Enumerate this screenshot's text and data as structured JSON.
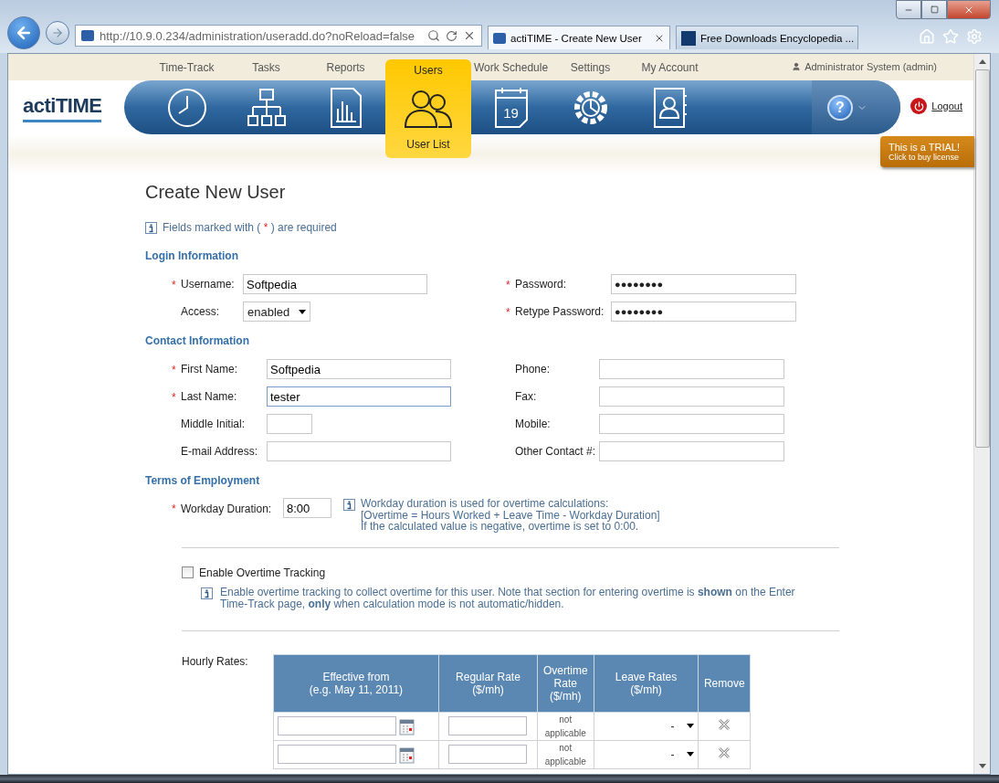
{
  "browser": {
    "url": "http://10.9.0.234/administration/useradd.do?noReload=false",
    "tabs": [
      {
        "title": "actiTIME - Create New User",
        "selected": true
      },
      {
        "title": "Free Downloads Encyclopedia ...",
        "selected": false
      }
    ]
  },
  "nav": {
    "tabs": [
      {
        "label": "Time-Track",
        "selected": false
      },
      {
        "label": "Tasks",
        "selected": false
      },
      {
        "label": "Reports",
        "selected": false
      },
      {
        "label": "Users",
        "selected": true,
        "sublabel": "User List"
      },
      {
        "label": "Work Schedule",
        "selected": false,
        "icon_text": "19"
      },
      {
        "label": "Settings",
        "selected": false
      },
      {
        "label": "My Account",
        "selected": false
      }
    ],
    "logo": "actiTIME",
    "help": "?",
    "user": "Administrator System (admin)",
    "logout": "Logout",
    "trial": {
      "title": "This is a TRIAL!",
      "subtitle": "Click to buy license"
    }
  },
  "form": {
    "title": "Create New User",
    "note": {
      "before": "Fields marked with (",
      "mark": "*",
      "after": ") are required"
    },
    "login": {
      "heading": "Login Information",
      "fields": [
        {
          "label": "Username:",
          "required": true,
          "kind": "text",
          "value": "Softpedia"
        },
        {
          "label": "Password:",
          "required": true,
          "kind": "password",
          "value": "●●●●●●●●"
        },
        {
          "label": "Access:",
          "required": false,
          "kind": "select",
          "value": "enabled"
        },
        {
          "label": "Retype Password:",
          "required": true,
          "kind": "password",
          "value": "●●●●●●●●"
        }
      ]
    },
    "contact": {
      "heading": "Contact Information",
      "fields": [
        {
          "label": "First Name:",
          "required": true,
          "value": "Softpedia",
          "focused": false
        },
        {
          "label": "Phone:",
          "required": false,
          "focused": false
        },
        {
          "label": "Last Name:",
          "required": true,
          "value": "tester",
          "focused": true
        },
        {
          "label": "Fax:",
          "required": false,
          "focused": false
        },
        {
          "label": "Middle Initial:",
          "required": false,
          "focused": false,
          "short": true
        },
        {
          "label": "Mobile:",
          "required": false,
          "focused": false
        },
        {
          "label": "E-mail Address:",
          "required": false,
          "focused": false
        },
        {
          "label": "Other Contact #:",
          "required": false,
          "focused": false
        }
      ]
    },
    "terms": {
      "heading": "Terms of Employment",
      "workday": {
        "label": "Workday Duration:",
        "required": true,
        "value": "8:00"
      },
      "info": [
        "Workday duration is used for overtime calculations:",
        "[Overtime = Hours Worked + Leave Time - Workday Duration]",
        "If the calculated value is negative, overtime is set to 0:00."
      ]
    },
    "overtime": {
      "label": "Enable Overtime Tracking",
      "checked": false,
      "info": "Enable overtime tracking to collect overtime for this user. Note that section for entering overtime is **shown** on the Enter Time-Track page, **only** when calculation mode is not automatic/hidden."
    },
    "rates": {
      "label": "Hourly Rates:",
      "columns": [
        "Effective from\n(e.g. May 11, 2011)",
        "Regular Rate\n($/mh)",
        "Overtime\nRate\n($/mh)",
        "Leave Rates\n($/mh)",
        "Remove"
      ],
      "rows": [
        {
          "effective": "",
          "regular": "",
          "overtime": "not\napplicable",
          "leave": "-"
        },
        {
          "effective": "",
          "regular": "",
          "overtime": "not\napplicable",
          "leave": "-"
        }
      ]
    }
  }
}
